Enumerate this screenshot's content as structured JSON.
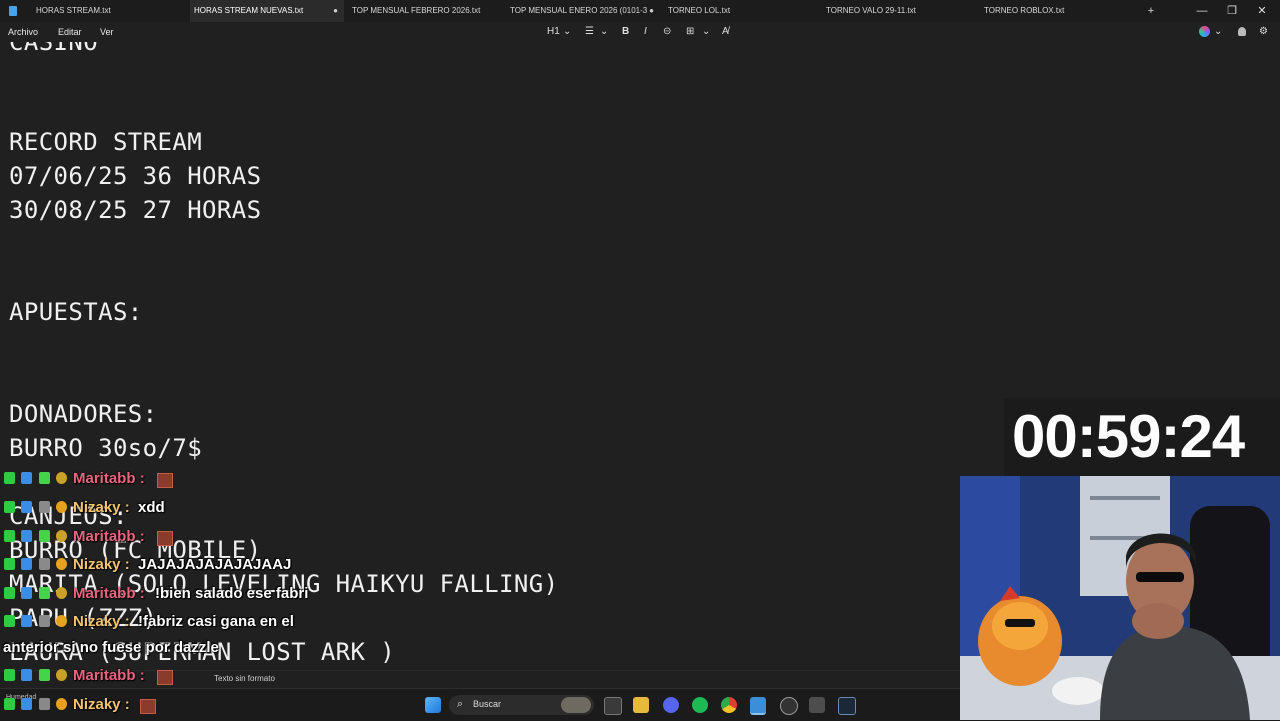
{
  "tabs": [
    {
      "label": "HORAS STREAM.txt",
      "active": false,
      "unsaved": false
    },
    {
      "label": "HORAS STREAM NUEVAS.txt",
      "active": true,
      "unsaved": true
    },
    {
      "label": "TOP MENSUAL FEBRERO 2026.txt",
      "active": false,
      "unsaved": false
    },
    {
      "label": "TOP MENSUAL ENERO 2026 (0101-3",
      "active": false,
      "unsaved": true
    },
    {
      "label": "TORNEO LOL.txt",
      "active": false,
      "unsaved": false
    },
    {
      "label": "TORNEO VALO 29-11.txt",
      "active": false,
      "unsaved": false
    },
    {
      "label": "TORNEO ROBLOX.txt",
      "active": false,
      "unsaved": false
    }
  ],
  "tab_actions": {
    "new_tab": "+",
    "minimize": "—",
    "maximize": "❐",
    "close": "✕"
  },
  "menu": {
    "file": "Archivo",
    "edit": "Editar",
    "view": "Ver"
  },
  "toolbar": {
    "heading": "H1",
    "heading_caret": "⌄",
    "list": "☰",
    "list_caret": "⌄",
    "bold": "B",
    "italic": "I",
    "link": "⊝",
    "table": "⊞",
    "table_caret": "⌄",
    "clear_format": "A̸",
    "copilot_caret": "⌄",
    "settings": "⚙"
  },
  "editor": {
    "lines": [
      "CASINO",
      "",
      "RECORD STREAM",
      "07/06/25 36 HORAS",
      "30/08/25 27 HORAS",
      "",
      "APUESTAS:",
      "",
      "DONADORES:",
      "BURRO 30so/7$",
      "",
      "CANJEOS:",
      "BURRO (FC MOBILE)",
      "MARITA (SOLO LEVELING HAIKYU FALLING)",
      "PAPU (ZZZ)",
      "LAURA (SUPERMAN LOST ARK )"
    ]
  },
  "status": {
    "format": "Texto sin formato"
  },
  "taskbar": {
    "search_placeholder": "Buscar",
    "weather": "Humedad"
  },
  "timer": {
    "value": "00:59:24"
  },
  "chat": [
    {
      "user": "Maritabb",
      "color": "#e8647f",
      "sep": ":",
      "text": "",
      "emote": true
    },
    {
      "user": "Nizaky",
      "color": "#f5c36b",
      "sep": ":",
      "text": "xdd",
      "emote": false
    },
    {
      "user": "Maritabb",
      "color": "#e8647f",
      "sep": ":",
      "text": "",
      "emote": true
    },
    {
      "user": "Nizaky",
      "color": "#f5c36b",
      "sep": ":",
      "text": "JAJAJAJAJAJAJAAJ",
      "emote": false
    },
    {
      "user": "Maritabb",
      "color": "#e8647f",
      "sep": ":",
      "text": "!bien salado ese fabri",
      "emote": false
    },
    {
      "user": "Nizaky",
      "color": "#f5c36b",
      "sep": ":",
      "text": "!fabriz casi gana en el",
      "emote": false
    },
    {
      "user": "",
      "color": "#ffffff",
      "sep": "",
      "text": "anterior si no fuese por dazzle",
      "emote": false
    },
    {
      "user": "Maritabb",
      "color": "#e8647f",
      "sep": ":",
      "text": "",
      "emote": true
    },
    {
      "user": "Nizaky",
      "color": "#f5c36b",
      "sep": ":",
      "text": "",
      "emote": true
    }
  ],
  "colors": {
    "bg": "#202020",
    "tabbar": "#1c1c1c",
    "accent": "#4aa3e8",
    "maritabb": "#e8647f",
    "nizaky": "#f5c36b"
  }
}
